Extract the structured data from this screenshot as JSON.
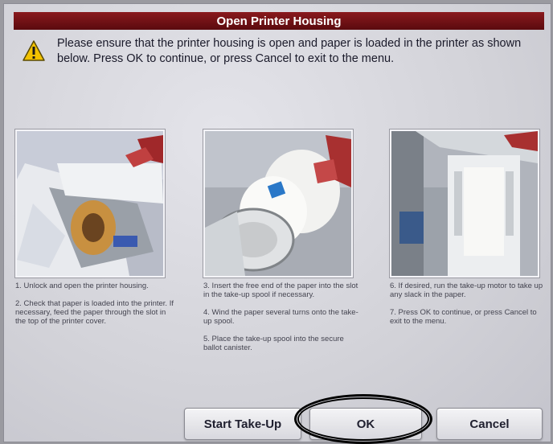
{
  "dialog": {
    "title": "Open Printer Housing",
    "message": "Please ensure that the printer housing is open and paper is loaded in the printer as shown below. Press OK to continue, or press Cancel to exit to the menu.",
    "icon": "warning-icon"
  },
  "columns": [
    {
      "image": "printer-housing-open-photo",
      "steps": [
        "1. Unlock and open the printer housing.",
        "2. Check that paper is loaded into the printer. If necessary, feed the paper through the slot in the top of the printer cover."
      ]
    },
    {
      "image": "take-up-spool-photo",
      "steps": [
        "3. Insert the free end of the paper into the slot in the take-up spool if necessary.",
        "4. Wind the paper several turns onto the take-up spool.",
        "5. Place the take-up spool into the secure ballot canister."
      ]
    },
    {
      "image": "take-up-motor-photo",
      "steps": [
        "6. If desired, run the take-up motor to take up any slack in the paper.",
        "7. Press OK to continue, or press Cancel to exit to the menu."
      ]
    }
  ],
  "buttons": {
    "start_takeup": "Start Take-Up",
    "ok": "OK",
    "cancel": "Cancel"
  },
  "colors": {
    "title_bar": "#6e0e12",
    "warning": "#f2c200"
  }
}
